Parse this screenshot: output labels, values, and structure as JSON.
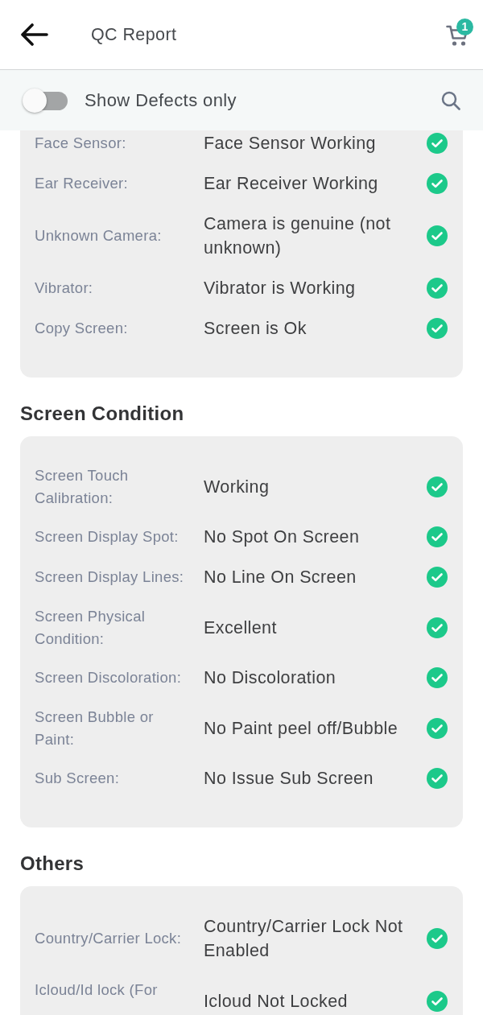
{
  "header": {
    "title": "QC Report",
    "cart_badge": "1"
  },
  "filter_bar": {
    "toggle": {
      "label": "Show Defects only",
      "on": false
    }
  },
  "sections": [
    {
      "rows": [
        {
          "label": "Face Sensor:",
          "value": "Face Sensor Working",
          "passed": true
        },
        {
          "label": "Ear Receiver:",
          "value": "Ear Receiver Working",
          "passed": true
        },
        {
          "label": "Unknown Camera:",
          "value": "Camera is genuine (not unknown)",
          "passed": true
        },
        {
          "label": "Vibrator:",
          "value": "Vibrator is Working",
          "passed": true
        },
        {
          "label": "Copy Screen:",
          "value": "Screen is Ok",
          "passed": true
        }
      ]
    },
    {
      "title": "Screen Condition",
      "rows": [
        {
          "label": "Screen Touch Calibration:",
          "value": "Working",
          "passed": true
        },
        {
          "label": "Screen Display Spot:",
          "value": "No Spot On Screen",
          "passed": true
        },
        {
          "label": "Screen Display Lines:",
          "value": "No Line On Screen",
          "passed": true
        },
        {
          "label": "Screen Physical Condition:",
          "value": "Excellent",
          "passed": true
        },
        {
          "label": "Screen Discoloration:",
          "value": "No Discoloration",
          "passed": true
        },
        {
          "label": "Screen Bubble or Paint:",
          "value": "No Paint peel off/Bubble",
          "passed": true
        },
        {
          "label": "Sub Screen:",
          "value": "No Issue Sub Screen",
          "passed": true
        }
      ]
    },
    {
      "title": "Others",
      "rows": [
        {
          "label": "Country/Carrier Lock:",
          "value": "Country/Carrier Lock Not Enabled",
          "passed": true
        },
        {
          "label": "Icloud/Id lock (For",
          "value": "Icloud Not Locked",
          "passed": true
        }
      ]
    }
  ]
}
